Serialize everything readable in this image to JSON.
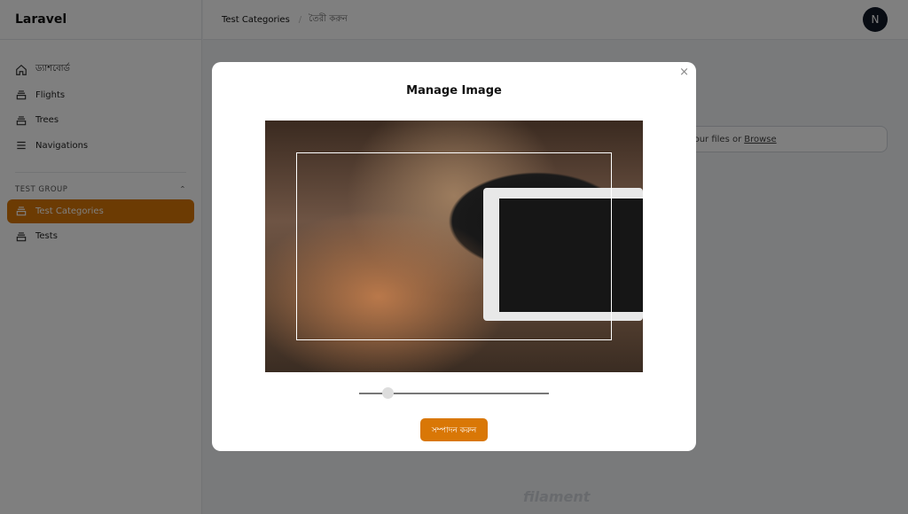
{
  "app": {
    "brand": "Laravel"
  },
  "sidebar": {
    "items": [
      {
        "label": "ড্যাশবোর্ড",
        "icon": "home-icon"
      },
      {
        "label": "Flights",
        "icon": "collection-icon"
      },
      {
        "label": "Trees",
        "icon": "collection-icon"
      },
      {
        "label": "Navigations",
        "icon": "menu-icon"
      }
    ],
    "group": {
      "label": "TEST GROUP",
      "items": [
        {
          "label": "Test Categories",
          "active": true
        },
        {
          "label": "Tests"
        }
      ]
    }
  },
  "breadcrumb": [
    "Test Categories",
    "তৈরী করুন"
  ],
  "user": {
    "initial": "N"
  },
  "upload": {
    "text": "Drag & Drop your files or",
    "browse": "Browse"
  },
  "footer": {
    "logo": "filament"
  },
  "modal": {
    "title": "Manage Image",
    "zoom_level": 0.15,
    "submit": "সম্পাদন করুন",
    "close": "×"
  },
  "colors": {
    "accent": "#d97706"
  }
}
